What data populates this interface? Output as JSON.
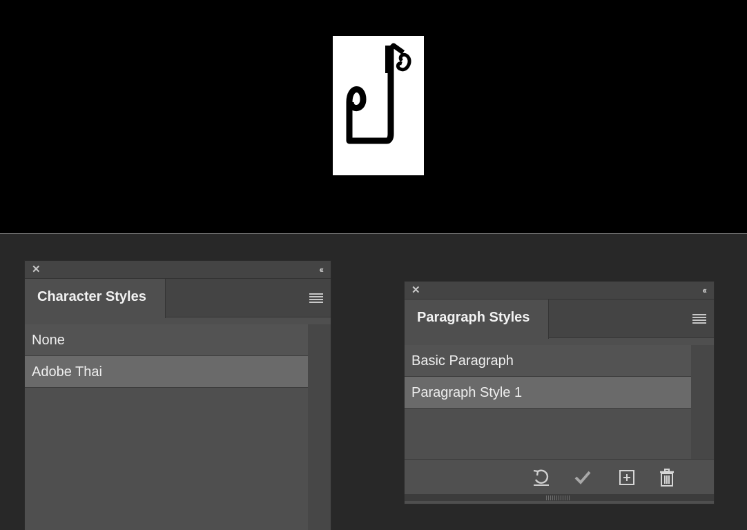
{
  "character_styles_panel": {
    "tab_label": "Character Styles",
    "close_icon": "close-icon",
    "collapse_icon": "double-chevron-left-icon",
    "collapse_glyph": "‹‹",
    "menu_icon": "panel-menu-icon",
    "items": [
      {
        "label": "None",
        "selected": false
      },
      {
        "label": "Adobe Thai",
        "selected": true
      }
    ]
  },
  "paragraph_styles_panel": {
    "tab_label": "Paragraph Styles",
    "close_icon": "close-icon",
    "collapse_icon": "double-chevron-left-icon",
    "collapse_glyph": "‹‹",
    "menu_icon": "panel-menu-icon",
    "items": [
      {
        "label": "Basic Paragraph",
        "selected": false
      },
      {
        "label": "Paragraph Style 1",
        "selected": true
      }
    ],
    "footer_buttons": [
      {
        "icon": "clear-overrides-icon"
      },
      {
        "icon": "checkmark-icon"
      },
      {
        "icon": "new-style-icon"
      },
      {
        "icon": "trash-icon"
      }
    ]
  },
  "colors": {
    "canvas_background": "#000000",
    "workspace_background": "#282828",
    "panel_background": "#4f4f4f",
    "selected_row": "#6a6a6a"
  }
}
